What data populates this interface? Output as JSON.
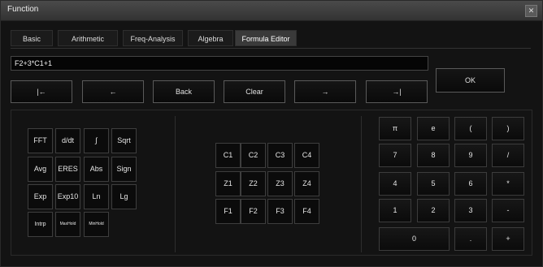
{
  "window": {
    "title": "Function",
    "close_symbol": "✕"
  },
  "tabs": [
    {
      "label": "Basic",
      "active": false
    },
    {
      "label": "Arithmetic",
      "active": false
    },
    {
      "label": "Freq-Analysis",
      "active": false
    },
    {
      "label": "Algebra",
      "active": false
    },
    {
      "label": "Formula Editor",
      "active": true
    }
  ],
  "formula": {
    "value": "F2+3*C1+1"
  },
  "toolbar": {
    "home": "|←",
    "left": "←",
    "back": "Back",
    "clear": "Clear",
    "right": "→",
    "end": "→|",
    "ok": "OK"
  },
  "functions": [
    [
      "FFT",
      "d/dt",
      "∫",
      "Sqrt"
    ],
    [
      "Avg",
      "ERES",
      "Abs",
      "Sign"
    ],
    [
      "Exp",
      "Exp10",
      "Ln",
      "Lg"
    ],
    [
      "Intrp",
      "MaxHold",
      "MinHold"
    ]
  ],
  "sources": [
    [
      "C1",
      "C2",
      "C3",
      "C4"
    ],
    [
      "Z1",
      "Z2",
      "Z3",
      "Z4"
    ],
    [
      "F1",
      "F2",
      "F3",
      "F4"
    ]
  ],
  "numpad": [
    [
      "π",
      "e",
      "(",
      ")"
    ],
    [
      "7",
      "8",
      "9",
      "/"
    ],
    [
      "4",
      "5",
      "6",
      "*"
    ],
    [
      "1",
      "2",
      "3",
      "-"
    ],
    [
      "0",
      ".",
      "+"
    ]
  ]
}
